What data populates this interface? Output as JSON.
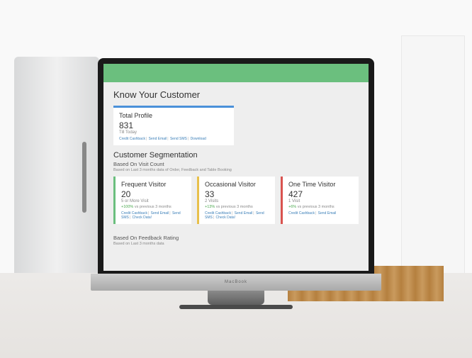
{
  "device": {
    "label": "MacBook"
  },
  "page": {
    "title": "Know Your Customer",
    "total_profile": {
      "title": "Total Profile",
      "value": "831",
      "subtitle": "Till Today",
      "links": {
        "cashback": "Credit Cashback",
        "email": "Send Email",
        "sms": "Send SMS",
        "download": "Download"
      }
    },
    "segmentation": {
      "title": "Customer Segmentation",
      "visit_count": {
        "subtitle": "Based On Visit Count",
        "note": "Based on Last 3 months data of Order, Feedback and Table Booking",
        "cards": [
          {
            "title": "Frequent Visitor",
            "value": "20",
            "sub": "5 or More Visit",
            "delta": "+100%",
            "delta_label": "vs previous 3 months"
          },
          {
            "title": "Occasional Visitor",
            "value": "33",
            "sub": "2 Visits",
            "delta": "+13%",
            "delta_label": "vs previous 3 months"
          },
          {
            "title": "One Time Visitor",
            "value": "427",
            "sub": "1 Visit",
            "delta": "+6%",
            "delta_label": "vs previous 3 months"
          }
        ],
        "card_links": {
          "cashback": "Credit Cashback",
          "email": "Send Email",
          "sms": "Send SMS",
          "extra": "Check Data!"
        }
      },
      "feedback": {
        "subtitle": "Based On Feedback Rating",
        "note": "Based on Last 3 months data"
      }
    }
  }
}
